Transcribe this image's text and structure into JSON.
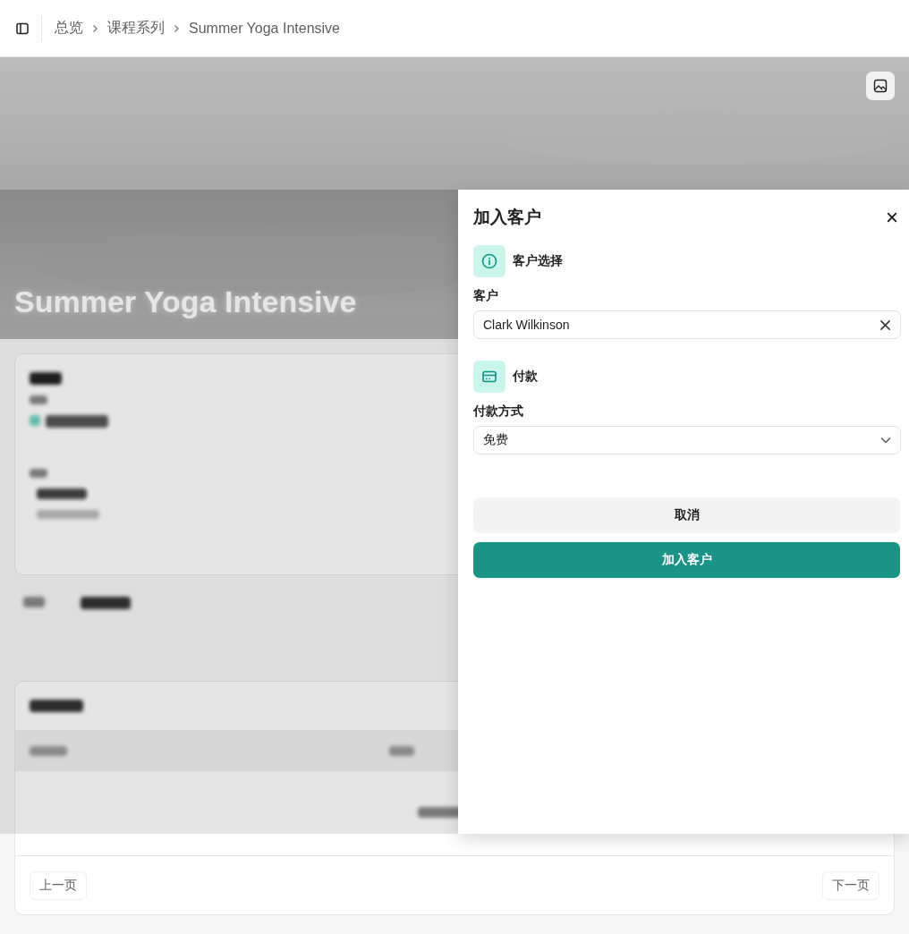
{
  "header": {
    "breadcrumbs": [
      {
        "label": "总览"
      },
      {
        "label": "课程系列"
      },
      {
        "label": "Summer Yoga Intensive"
      }
    ]
  },
  "hero": {
    "title": "Summer Yoga Intensive"
  },
  "pagination": {
    "previous": "上一页",
    "next": "下一页"
  },
  "drawer": {
    "title": "加入客户",
    "sections": [
      {
        "kind": "customer",
        "heading": "客户选择",
        "label": "客户",
        "value": "Clark Wilkinson"
      },
      {
        "kind": "payment",
        "heading": "付款",
        "label": "付款方式",
        "value": "免费"
      }
    ],
    "buttons": [
      {
        "kind": "secondary",
        "label": "取消"
      },
      {
        "kind": "primary",
        "label": "加入客户"
      }
    ]
  }
}
